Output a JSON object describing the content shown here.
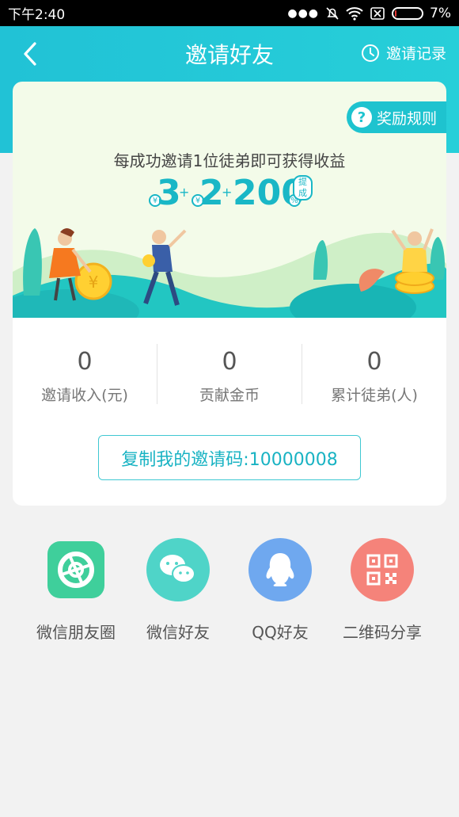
{
  "status": {
    "time": "下午2:40",
    "battery": "7%",
    "battery_level": 0.07
  },
  "nav": {
    "title": "邀请好友",
    "records_label": "邀请记录"
  },
  "banner": {
    "rules_label": "奖励规则",
    "headline": "每成功邀请1位徒弟即可获得收益",
    "rewards": {
      "first": "3",
      "second": "2",
      "third": "200",
      "tag": "提成",
      "currency": "¥",
      "percent": "%",
      "plus": "+"
    }
  },
  "stats": [
    {
      "value": "0",
      "label": "邀请收入(元)"
    },
    {
      "value": "0",
      "label": "贡献金币"
    },
    {
      "value": "0",
      "label": "累计徒弟(人)"
    }
  ],
  "copy_button": "复制我的邀请码:10000008",
  "share": [
    {
      "label": "微信朋友圈",
      "icon": "moments-icon",
      "color": "#3fcf9b"
    },
    {
      "label": "微信好友",
      "icon": "wechat-icon",
      "color": "#4fd4c8"
    },
    {
      "label": "QQ好友",
      "icon": "qq-icon",
      "color": "#6fa8ef"
    },
    {
      "label": "二维码分享",
      "icon": "qrcode-icon",
      "color": "#f5837a"
    }
  ],
  "colors": {
    "primary": "#21c2d6",
    "accent": "#19b7c6",
    "background": "#f2f2f2"
  }
}
